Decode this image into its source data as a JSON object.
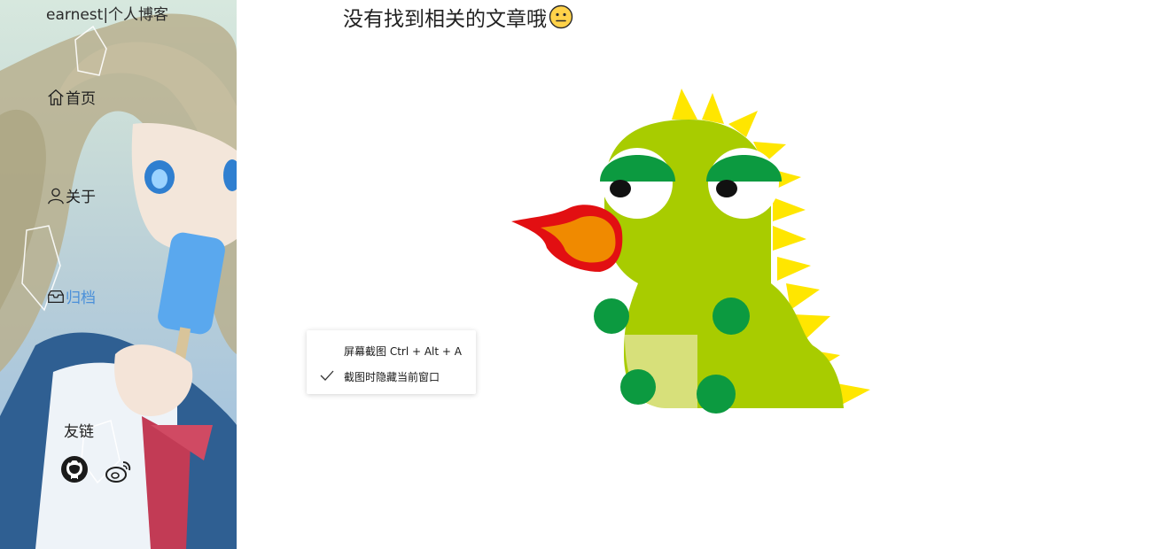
{
  "sidebar": {
    "site_title": "earnest|个人博客",
    "nav": {
      "home": "首页",
      "about": "关于",
      "archive": "归档"
    },
    "friends_label": "友链",
    "social_icons": [
      "github-icon",
      "weibo-icon"
    ]
  },
  "main": {
    "empty_message": "没有找到相关的文章哦",
    "empty_emoji": "neutral-face-icon",
    "illustration": "dinosaur-breathing-fire"
  },
  "context_menu": {
    "items": [
      {
        "label": "屏幕截图 Ctrl + Alt + A",
        "checked": false
      },
      {
        "label": "截图时隐藏当前窗口",
        "checked": true
      }
    ]
  },
  "colors": {
    "active_nav": "#4a90d9",
    "dino_body": "#a8cc00",
    "dino_spots": "#0c9a40",
    "dino_spikes": "#ffe600",
    "fire_outer": "#e20f12",
    "fire_inner": "#f08a00"
  }
}
